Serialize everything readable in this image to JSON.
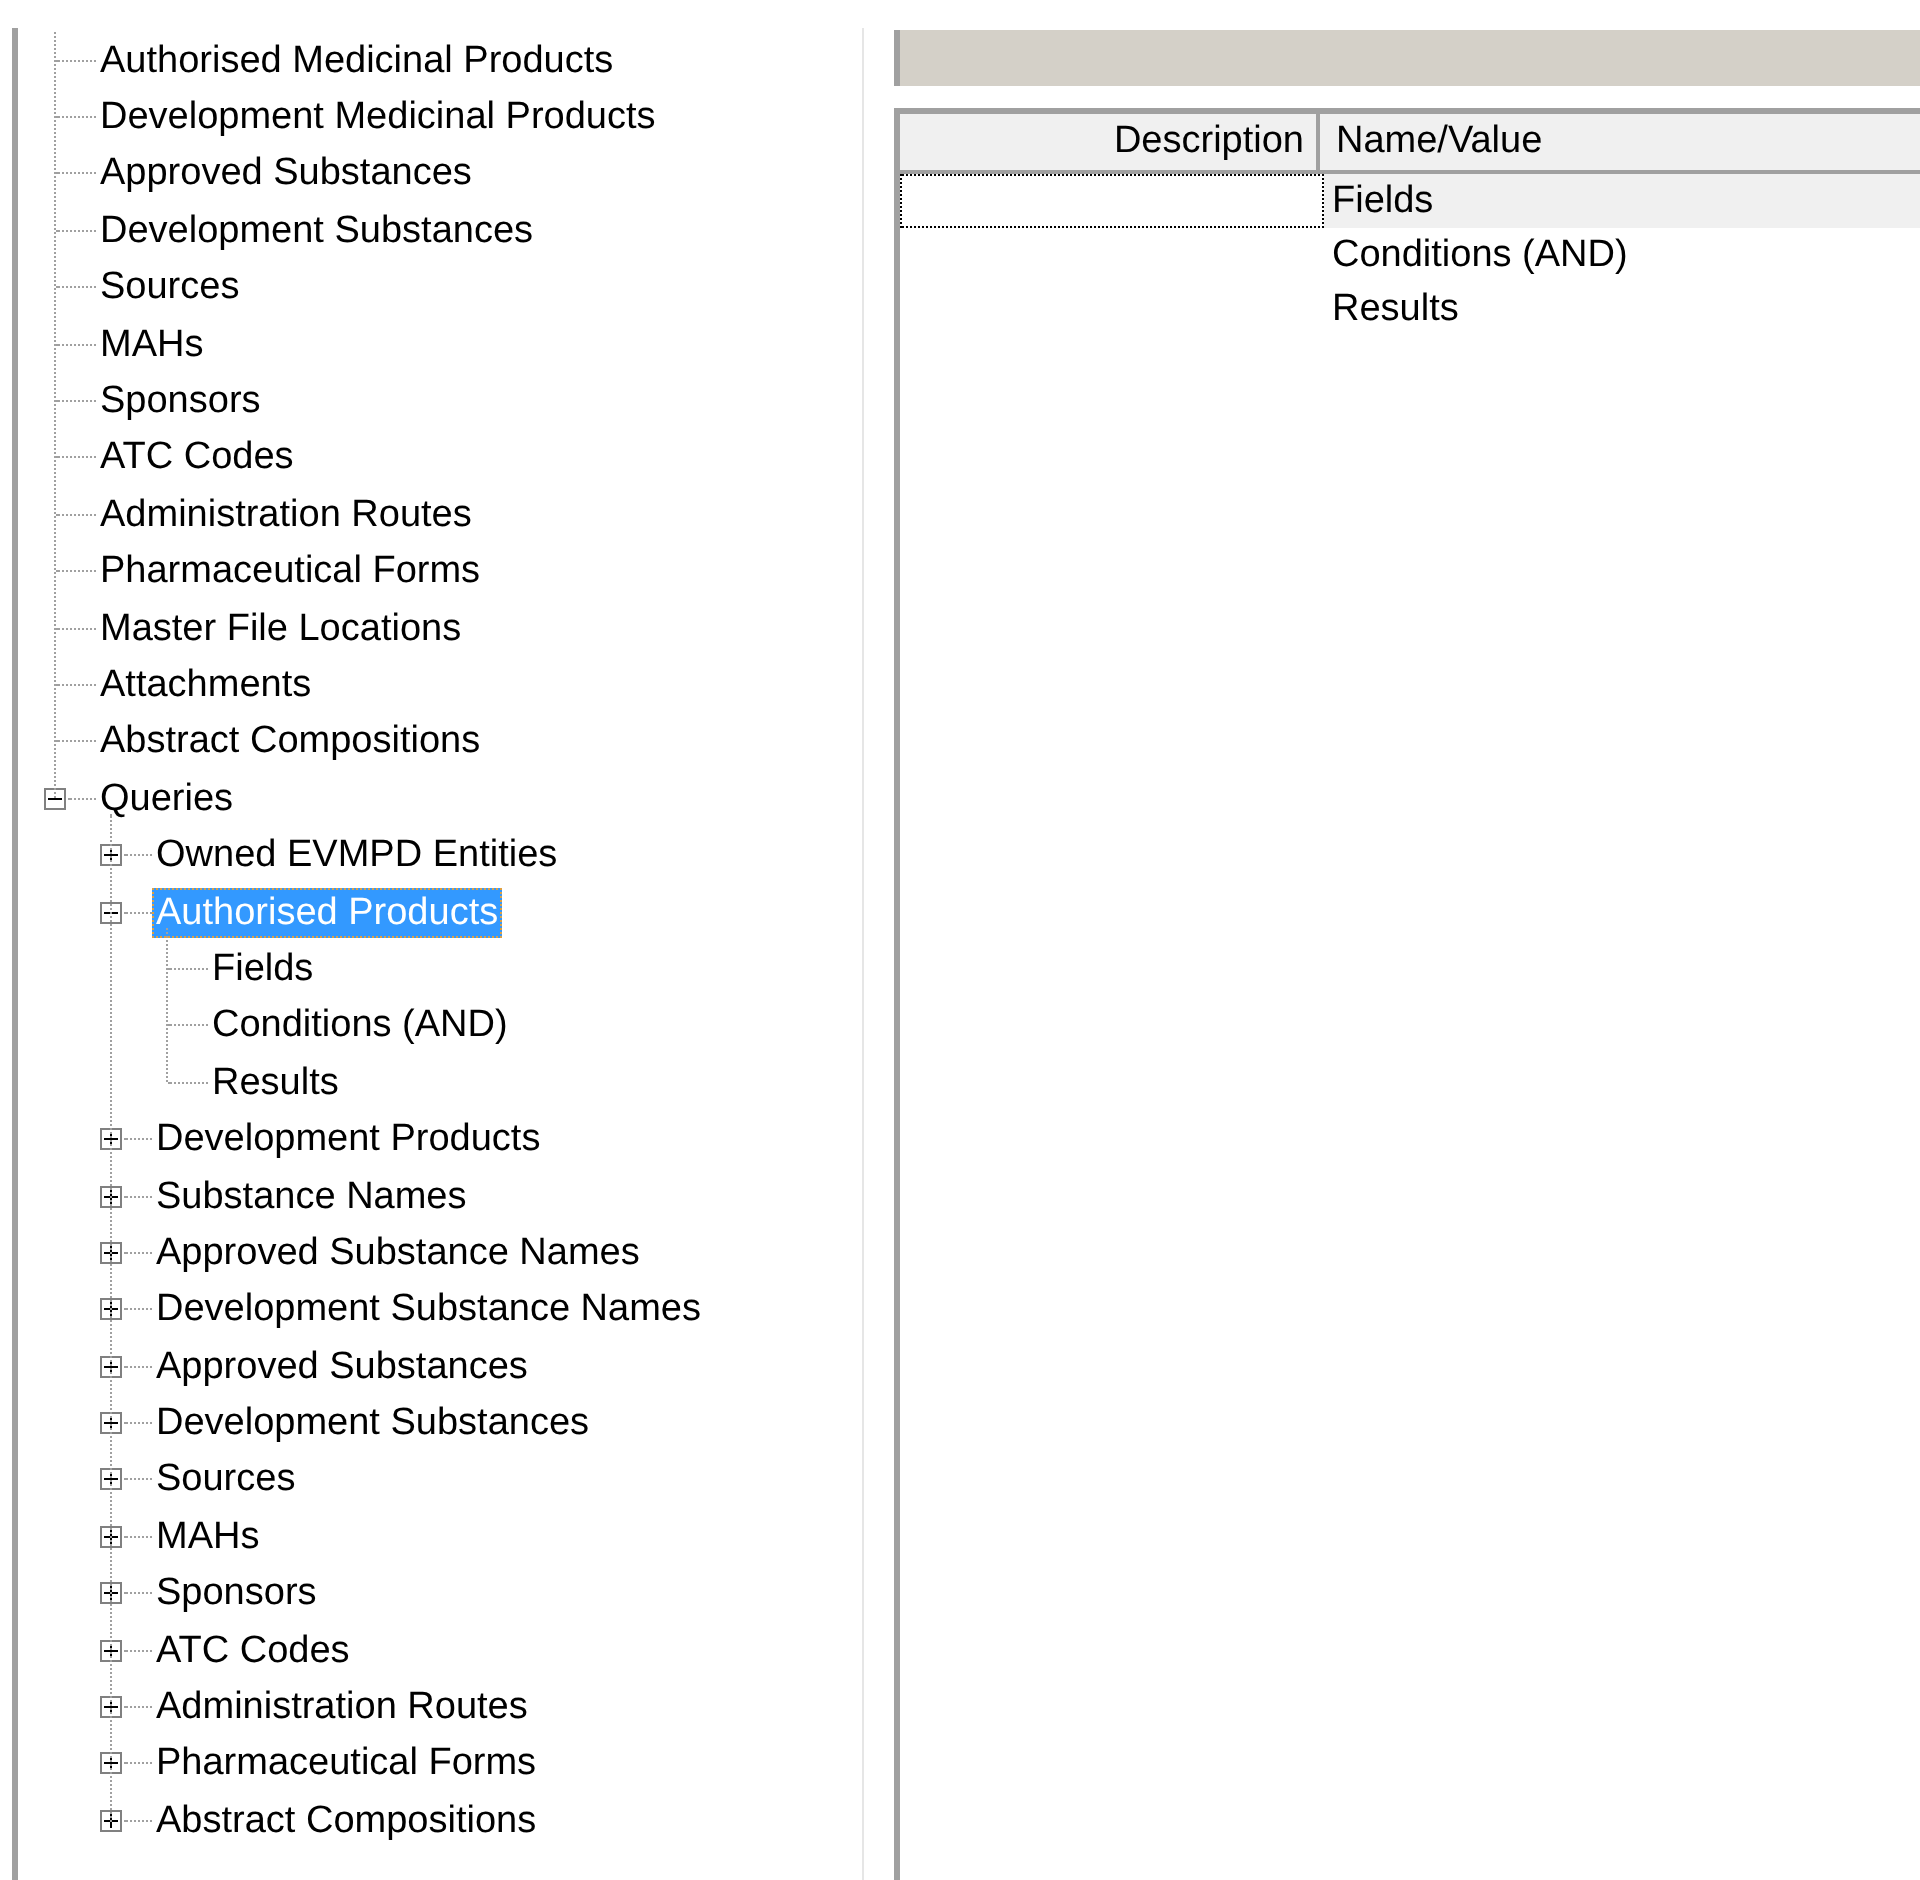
{
  "tree": [
    {
      "label": "Authorised Medicinal Products",
      "selected": false
    },
    {
      "label": "Development Medicinal Products",
      "selected": false
    },
    {
      "label": "Approved Substances",
      "selected": false
    },
    {
      "label": "Development Substances",
      "selected": false
    },
    {
      "label": "Sources",
      "selected": false
    },
    {
      "label": "MAHs",
      "selected": false
    },
    {
      "label": "Sponsors",
      "selected": false
    },
    {
      "label": "ATC Codes",
      "selected": false
    },
    {
      "label": "Administration Routes",
      "selected": false
    },
    {
      "label": "Pharmaceutical Forms",
      "selected": false
    },
    {
      "label": "Master File Locations",
      "selected": false
    },
    {
      "label": "Attachments",
      "selected": false
    },
    {
      "label": "Abstract Compositions",
      "selected": false
    },
    {
      "label": "Queries",
      "selected": false,
      "expanded": true,
      "children": [
        {
          "label": "Owned EVMPD Entities",
          "selected": false,
          "expanded": false
        },
        {
          "label": "Authorised Products",
          "selected": true,
          "expanded": true,
          "children": [
            {
              "label": "Fields",
              "selected": false
            },
            {
              "label": "Conditions (AND)",
              "selected": false
            },
            {
              "label": "Results",
              "selected": false
            }
          ]
        },
        {
          "label": "Development Products",
          "selected": false,
          "expanded": false
        },
        {
          "label": "Substance Names",
          "selected": false,
          "expanded": false
        },
        {
          "label": "Approved Substance Names",
          "selected": false,
          "expanded": false
        },
        {
          "label": "Development Substance Names",
          "selected": false,
          "expanded": false
        },
        {
          "label": "Approved Substances",
          "selected": false,
          "expanded": false
        },
        {
          "label": "Development Substances",
          "selected": false,
          "expanded": false
        },
        {
          "label": "Sources",
          "selected": false,
          "expanded": false
        },
        {
          "label": "MAHs",
          "selected": false,
          "expanded": false
        },
        {
          "label": "Sponsors",
          "selected": false,
          "expanded": false
        },
        {
          "label": "ATC Codes",
          "selected": false,
          "expanded": false
        },
        {
          "label": "Administration Routes",
          "selected": false,
          "expanded": false
        },
        {
          "label": "Pharmaceutical Forms",
          "selected": false,
          "expanded": false
        },
        {
          "label": "Abstract Compositions",
          "selected": false,
          "expanded": false
        }
      ]
    }
  ],
  "table": {
    "columns": [
      "Description",
      "Name/Value"
    ],
    "rows": [
      {
        "name_value": "Fields",
        "selected": true
      },
      {
        "name_value": "Conditions (AND)",
        "selected": false
      },
      {
        "name_value": "Results",
        "selected": false
      }
    ]
  }
}
